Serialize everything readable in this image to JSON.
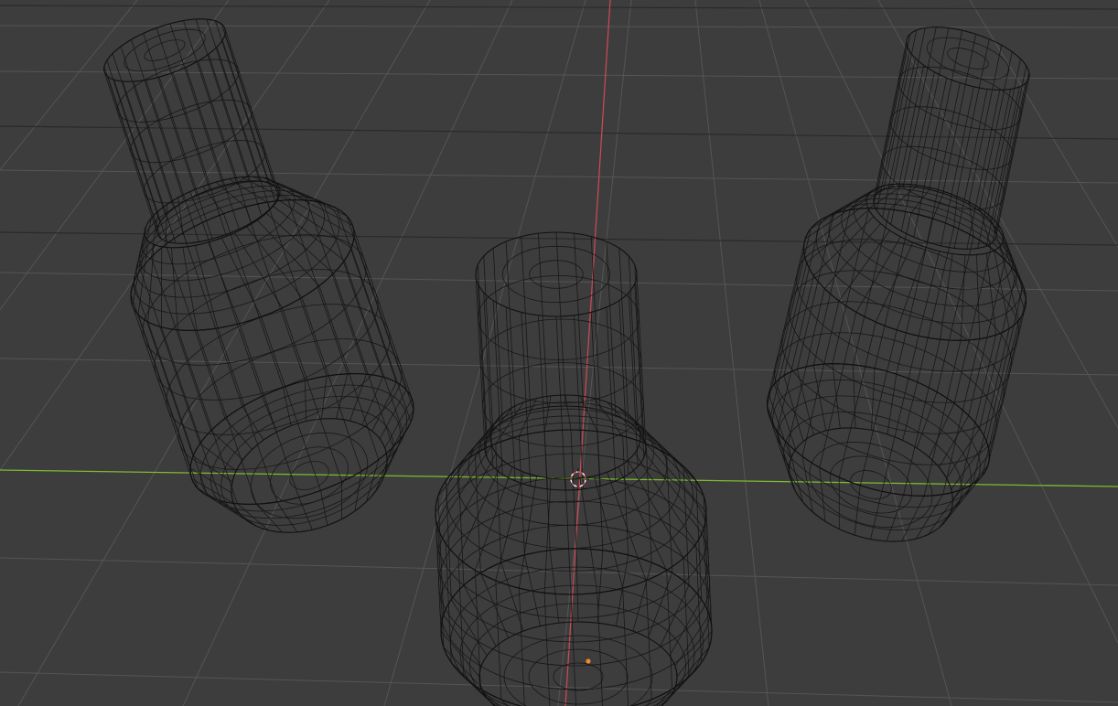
{
  "app": "3D viewport",
  "view": {
    "shading_mode": "wireframe",
    "background_color": "#3d3d3d",
    "grid_color": "#555555",
    "wire_color": "#151515",
    "x_axis_color": "#d04a57",
    "y_axis_color": "#7dbb2f",
    "cursor_color": "#ffffff",
    "origin_color": "#f08a24"
  },
  "scene": {
    "objects": [
      {
        "name": "bottle-left",
        "kind": "bottle-mesh"
      },
      {
        "name": "bottle-center",
        "kind": "bottle-mesh"
      },
      {
        "name": "bottle-right",
        "kind": "bottle-mesh"
      }
    ],
    "icons": {
      "cursor": "3d-cursor-icon",
      "origin": "object-origin-dot"
    }
  }
}
